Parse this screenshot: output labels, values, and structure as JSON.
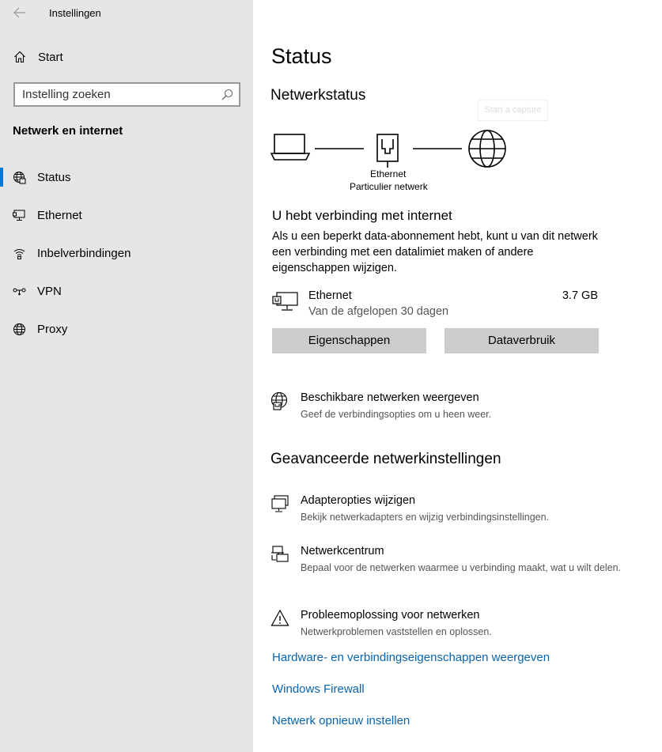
{
  "window": {
    "title": "Instellingen"
  },
  "sidebar": {
    "home_label": "Start",
    "search_placeholder": "Instelling zoeken",
    "section_title": "Netwerk en internet",
    "items": [
      {
        "label": "Status",
        "icon": "status-globe-icon",
        "selected": true
      },
      {
        "label": "Ethernet",
        "icon": "ethernet-icon"
      },
      {
        "label": "Inbelverbindingen",
        "icon": "dialup-icon"
      },
      {
        "label": "VPN",
        "icon": "vpn-icon"
      },
      {
        "label": "Proxy",
        "icon": "globe-icon"
      }
    ],
    "accent_color": "#0078d7"
  },
  "main": {
    "page_title": "Status",
    "network_status_heading": "Netwerkstatus",
    "capture_hint": "Start a capture",
    "diagram": {
      "device_label": "Ethernet",
      "network_label": "Particulier netwerk"
    },
    "connection_title": "U hebt verbinding met internet",
    "connection_desc": "Als u een beperkt data-abonnement hebt, kunt u van dit netwerk een verbinding met een datalimiet maken of andere eigenschappen wijzigen.",
    "ethernet": {
      "name": "Ethernet",
      "period": "Van de afgelopen 30 dagen",
      "usage": "3.7 GB"
    },
    "buttons": {
      "properties": "Eigenschappen",
      "data_usage": "Dataverbruik"
    },
    "available_networks": {
      "title": "Beschikbare netwerken weergeven",
      "subtitle": "Geef de verbindingsopties om u heen weer."
    },
    "advanced_heading": "Geavanceerde netwerkinstellingen",
    "advanced_items": [
      {
        "title": "Adapteropties wijzigen",
        "subtitle": "Bekijk netwerkadapters en wijzig verbindingsinstellingen.",
        "icon": "adapter-icon"
      },
      {
        "title": "Netwerkcentrum",
        "subtitle": "Bepaal voor de netwerken waarmee u verbinding maakt, wat u wilt delen.",
        "icon": "network-center-icon"
      },
      {
        "title": "Probleemoplossing voor netwerken",
        "subtitle": "Netwerkproblemen vaststellen en oplossen.",
        "icon": "warning-icon"
      }
    ],
    "links": {
      "hardware": "Hardware- en verbindingseigenschappen weergeven",
      "firewall": "Windows Firewall",
      "reset": "Netwerk opnieuw instellen"
    },
    "link_color": "#0a64ad"
  }
}
